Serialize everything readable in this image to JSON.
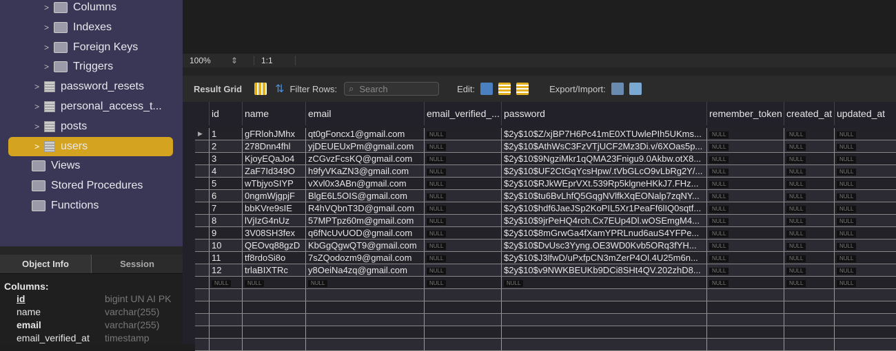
{
  "sidebar": {
    "items": [
      {
        "label": "Columns",
        "level": 2,
        "kind": "folder"
      },
      {
        "label": "Indexes",
        "level": 2,
        "kind": "folder"
      },
      {
        "label": "Foreign Keys",
        "level": 2,
        "kind": "folder"
      },
      {
        "label": "Triggers",
        "level": 2,
        "kind": "folder"
      },
      {
        "label": "password_resets",
        "level": 1,
        "kind": "table"
      },
      {
        "label": "personal_access_t...",
        "level": 1,
        "kind": "table"
      },
      {
        "label": "posts",
        "level": 1,
        "kind": "table"
      },
      {
        "label": "users",
        "level": 1,
        "kind": "table",
        "selected": true
      },
      {
        "label": "Views",
        "level": 0,
        "kind": "folder"
      },
      {
        "label": "Stored Procedures",
        "level": 0,
        "kind": "folder"
      },
      {
        "label": "Functions",
        "level": 0,
        "kind": "folder"
      }
    ],
    "selected_color": "#d4a420"
  },
  "tabs": {
    "object_info": "Object Info",
    "session": "Session"
  },
  "info": {
    "title": "Columns:",
    "columns": [
      {
        "name": "id",
        "type": "bigint UN AI PK"
      },
      {
        "name": "name",
        "type": "varchar(255)"
      },
      {
        "name": "email",
        "type": "varchar(255)"
      },
      {
        "name": "email_verified_at",
        "type": "timestamp"
      }
    ]
  },
  "statusbar": {
    "zoom": "100%",
    "position": "1:1"
  },
  "toolbar": {
    "result_grid": "Result Grid",
    "filter_rows": "Filter Rows:",
    "search_placeholder": "Search",
    "edit": "Edit:",
    "export_import": "Export/Import:"
  },
  "grid": {
    "columns": [
      "id",
      "name",
      "email",
      "email_verified_...",
      "password",
      "remember_token",
      "created_at",
      "updated_at"
    ],
    "null_label": "NULL",
    "rows": [
      [
        "1",
        "gFRlohJMhx",
        "qt0gFoncx1@gmail.com",
        null,
        "$2y$10$Z/xjBP7H6Pc41mE0XTUwlePIh5UKms...",
        null,
        null,
        null
      ],
      [
        "2",
        "278Dnn4fhl",
        "yjDEUEUxPm@gmail.com",
        null,
        "$2y$10$AthWsC3FzVTjUCF2Mz3Di.v/6XOas5p...",
        null,
        null,
        null
      ],
      [
        "3",
        "KjoyEQaJo4",
        "zCGvzFcsKQ@gmail.com",
        null,
        "$2y$10$9NgziMkr1qQMA23Fnigu9.0Akbw.otX8...",
        null,
        null,
        null
      ],
      [
        "4",
        "ZaF7Id349O",
        "h9fyVKaZN3@gmail.com",
        null,
        "$2y$10$UF2CtGqYcsHpw/.tVbGLcO9vLbRg2Y/...",
        null,
        null,
        null
      ],
      [
        "5",
        "wTbjyoSIYP",
        "vXvl0x3ABn@gmail.com",
        null,
        "$2y$10$RJkWEprVXt.539Rp5klgneHKkJ7.FHz...",
        null,
        null,
        null
      ],
      [
        "6",
        "0ngmWjgpjF",
        "BlgE6L5OIS@gmail.com",
        null,
        "$2y$10$tu6BvLhfQ5GqgNVlfkXqEONalp7zqNY...",
        null,
        null,
        null
      ],
      [
        "7",
        "bbKVre9sIE",
        "R4hVQbnT3D@gmail.com",
        null,
        "$2y$10$hdf6JaeJSp2KoPIL5Xr1PeaFf6lIQ0sqtf...",
        null,
        null,
        null
      ],
      [
        "8",
        "lVjIzG4nUz",
        "57MPTpz60m@gmail.com",
        null,
        "$2y$10$9jrPeHQ4rch.Cx7EUp4Dl.wOSEmgM4...",
        null,
        null,
        null
      ],
      [
        "9",
        "3V08SH3fex",
        "q6fNcUvUOD@gmail.com",
        null,
        "$2y$10$8mGrwGa4fXamYPRLnud6auS4YFPe...",
        null,
        null,
        null
      ],
      [
        "10",
        "QEOvq88gzD",
        "KbGgQgwQT9@gmail.com",
        null,
        "$2y$10$DvUsc3Yyng.OE3WD0Kvb5ORq3fYH...",
        null,
        null,
        null
      ],
      [
        "11",
        "tf8rdoSi8o",
        "7sZQodozm9@gmail.com",
        null,
        "$2y$10$J3lfwD/uPxfpCN3mZerP4Ol.4U25m6n...",
        null,
        null,
        null
      ],
      [
        "12",
        "trlaBIXTRc",
        "y8OeiNa4zq@gmail.com",
        null,
        "$2y$10$v9NWKBEUKb9DCi8SHt4QV.202zhD8...",
        null,
        null,
        null
      ],
      [
        null,
        null,
        null,
        null,
        null,
        null,
        null,
        null
      ]
    ]
  }
}
